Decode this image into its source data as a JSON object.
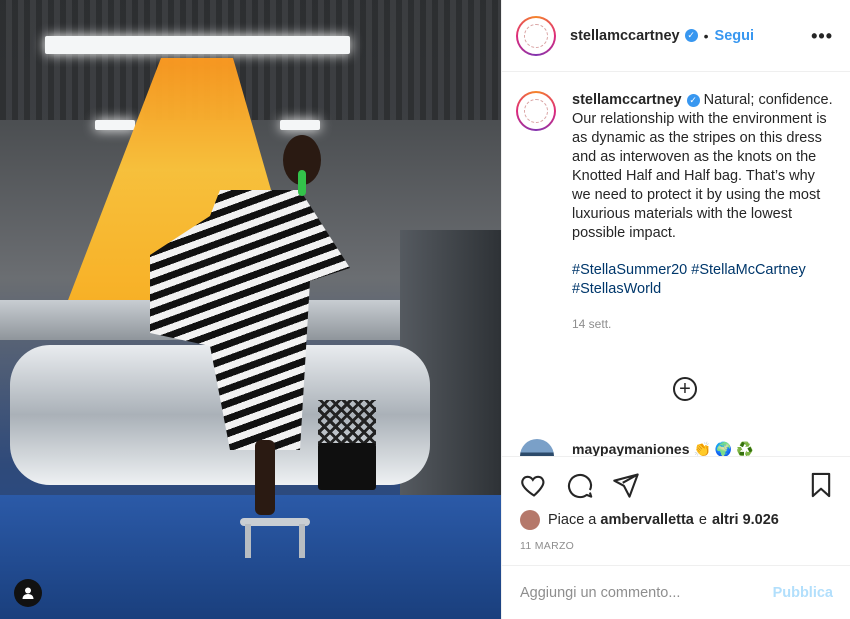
{
  "post": {
    "username": "stellamccartney",
    "verified": true,
    "follow_label": "Segui",
    "separator": "•",
    "more_label": "•••"
  },
  "caption": {
    "username": "stellamccartney",
    "text": "Natural; confidence. Our relationship with the environment is as dynamic as the stripes on this dress and as interwoven as the knots on the Knotted Half and Half bag. That’s why we need to protect it by using the most luxurious materials with the lowest possible impact.",
    "hashtags": [
      "#StellaSummer20",
      "#StellaMcCartney",
      "#StellasWorld"
    ],
    "time_ago": "14 sett."
  },
  "comment_preview": {
    "username": "maypaymaniones",
    "emoji": "👏 🌍 ♻️"
  },
  "likes": {
    "prefix": "Piace a",
    "liker": "ambervalletta",
    "conjunction": "e",
    "others": "altri 9.026"
  },
  "date": "11 MARZO",
  "comment_input": {
    "placeholder": "Aggiungi un commento...",
    "publish_label": "Pubblica"
  },
  "icons": [
    "heart-icon",
    "comment-icon",
    "share-icon",
    "bookmark-icon",
    "plus-circle-icon",
    "user-tag-icon",
    "verified-icon"
  ],
  "colors": {
    "link": "#3897f0",
    "hashtag": "#00376b",
    "muted": "#8e8e8e",
    "publish_disabled": "#b2dffc"
  }
}
